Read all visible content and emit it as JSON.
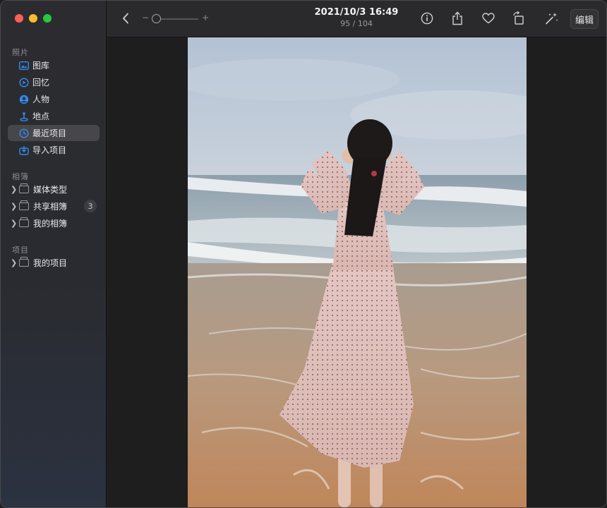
{
  "sidebar": {
    "sections": {
      "photos": "照片",
      "albums": "相簿",
      "projects": "项目"
    },
    "library_items": [
      {
        "label": "图库",
        "icon": "photo-library-icon"
      },
      {
        "label": "回忆",
        "icon": "memories-icon"
      },
      {
        "label": "人物",
        "icon": "people-icon"
      },
      {
        "label": "地点",
        "icon": "places-icon"
      },
      {
        "label": "最近项目",
        "icon": "recents-icon",
        "active": true
      },
      {
        "label": "导入项目",
        "icon": "imports-icon"
      }
    ],
    "album_items": [
      {
        "label": "媒体类型",
        "icon": "folder-icon"
      },
      {
        "label": "共享相簿",
        "icon": "shared-folder-icon",
        "badge": "3"
      },
      {
        "label": "我的相簿",
        "icon": "folder-icon"
      }
    ],
    "project_items": [
      {
        "label": "我的项目",
        "icon": "folder-icon"
      }
    ]
  },
  "toolbar": {
    "date": "2021/10/3 16:49",
    "count": "95 / 104",
    "zoom_minus": "−",
    "zoom_plus": "+",
    "zoom_level": 0.1,
    "edit_label": "编辑"
  },
  "colors": {
    "accent": "#2f8cf0",
    "sidebar_bg": "#2c2c30",
    "toolbar_bg": "#2a2a2d",
    "viewer_bg": "#1e1e1e"
  }
}
